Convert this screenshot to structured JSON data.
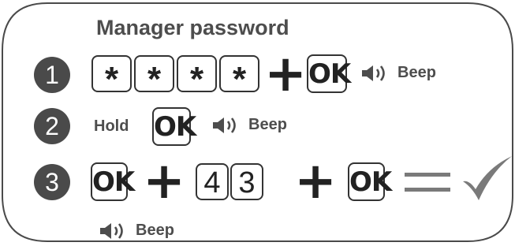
{
  "title": "Manager password",
  "steps": [
    {
      "number": "1",
      "keys": [
        "*",
        "*",
        "*",
        "*"
      ],
      "plus": "+",
      "ok": "OK",
      "beep_label": "Beep"
    },
    {
      "number": "2",
      "hold_label": "Hold",
      "ok": "OK",
      "beep_label": "Beep"
    },
    {
      "number": "3",
      "ok_first": "OK",
      "plus_1": "+",
      "digits": [
        "4",
        "3"
      ],
      "plus_2": "+",
      "ok_last": "OK",
      "beep_label": "Beep"
    }
  ],
  "icons": {
    "speaker": "speaker-icon",
    "equals": "equals-icon",
    "check": "checkmark-icon"
  },
  "colors": {
    "circle": "#4a4a4a",
    "text": "#4d4d4d",
    "key_border": "#333333",
    "frame": "#4a4a4a"
  }
}
